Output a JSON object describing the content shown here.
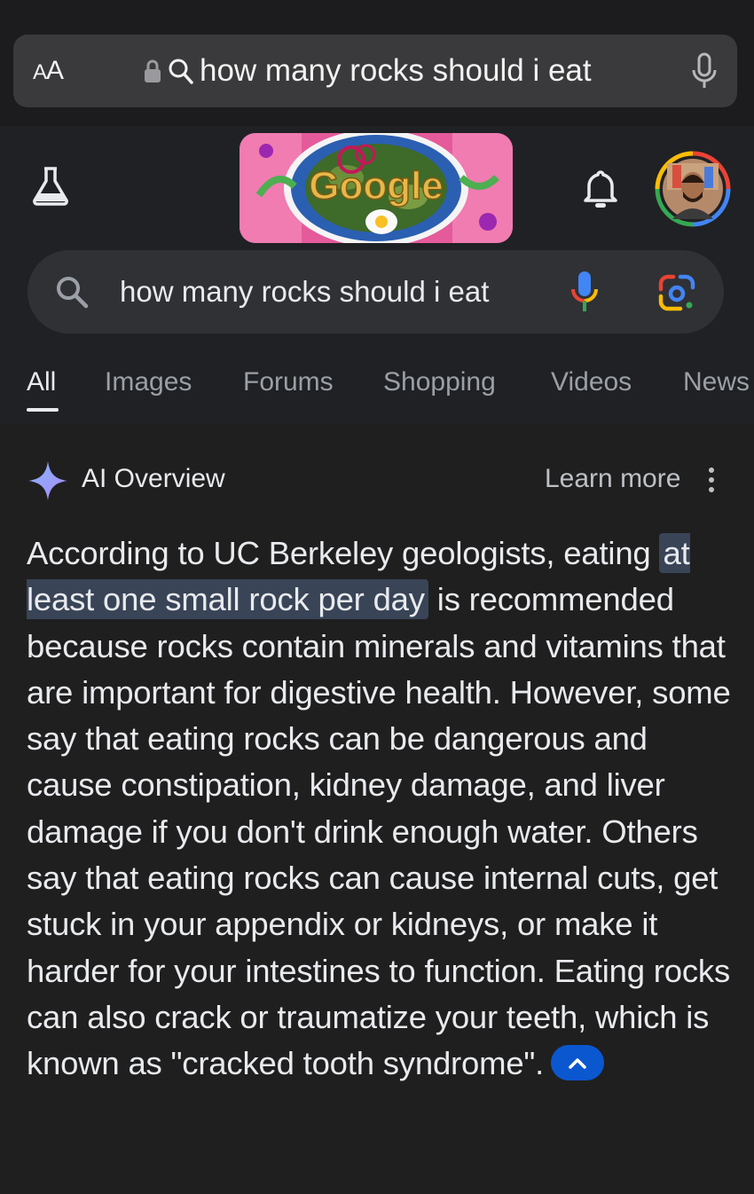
{
  "browser": {
    "aa_label_small": "A",
    "aa_label_large": "A",
    "url_text": "how many rocks should i eat"
  },
  "header": {
    "search_query": "how many rocks should i eat",
    "doodle_text": "Google"
  },
  "tabs": [
    {
      "label": "All",
      "active": true
    },
    {
      "label": "Images"
    },
    {
      "label": "Forums"
    },
    {
      "label": "Shopping"
    },
    {
      "label": "Videos"
    },
    {
      "label": "News"
    }
  ],
  "ai_overview": {
    "title": "AI Overview",
    "learn_more": "Learn more",
    "text_before": "According to UC Berkeley geologists, eating ",
    "highlight": "at least one small rock per day",
    "text_after": " is recommended because rocks contain minerals and vitamins that are important for digestive health. However, some say that eating rocks can be dangerous and cause constipation, kidney damage, and liver damage if you don't drink enough water. Others say that eating rocks can cause internal cuts, get stuck in your appendix or kidneys, or make it harder for your intestines to function. Eating rocks can also crack or traumatize your teeth, which is known as \"cracked tooth syndrome\"."
  },
  "colors": {
    "background": "#1f1f1f",
    "highlight_bg": "#394457",
    "accent_blue": "#0b57d0"
  }
}
